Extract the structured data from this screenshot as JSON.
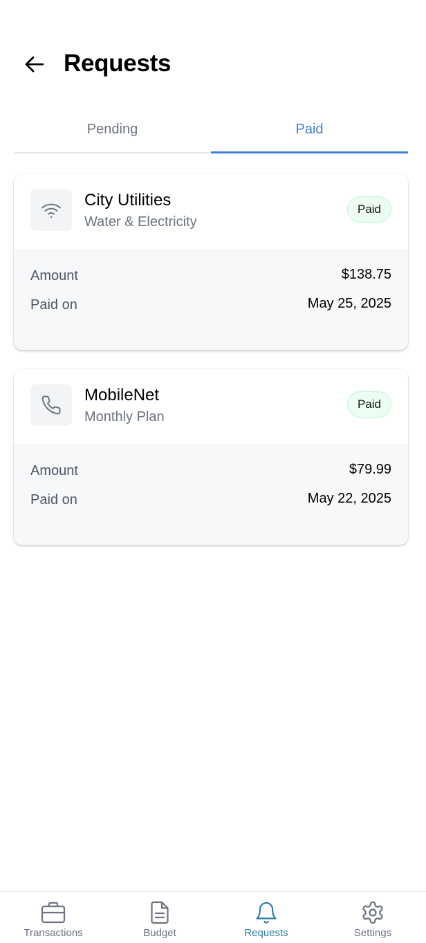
{
  "header": {
    "title": "Requests",
    "back_icon": "arrow-left-icon"
  },
  "tabs": [
    {
      "label": "Pending",
      "active": false
    },
    {
      "label": "Paid",
      "active": true
    }
  ],
  "requests": [
    {
      "icon": "wifi-icon",
      "title": "City Utilities",
      "subtitle": "Water & Electricity",
      "status": "Paid",
      "amount_label": "Amount",
      "amount": "$138.75",
      "paid_on_label": "Paid on",
      "paid_on": "May 25, 2025"
    },
    {
      "icon": "phone-icon",
      "title": "MobileNet",
      "subtitle": "Monthly Plan",
      "status": "Paid",
      "amount_label": "Amount",
      "amount": "$79.99",
      "paid_on_label": "Paid on",
      "paid_on": "May 22, 2025"
    }
  ],
  "bottom_nav": [
    {
      "label": "Transactions",
      "icon": "briefcase-icon",
      "active": false
    },
    {
      "label": "Budget",
      "icon": "document-icon",
      "active": false
    },
    {
      "label": "Requests",
      "icon": "bell-icon",
      "active": true
    },
    {
      "label": "Settings",
      "icon": "gear-icon",
      "active": false
    }
  ],
  "colors": {
    "accent": "#3b7dd8",
    "nav_active": "#2f7fa3",
    "badge_bg": "#ecfdf3",
    "muted_text": "#6b7280"
  }
}
